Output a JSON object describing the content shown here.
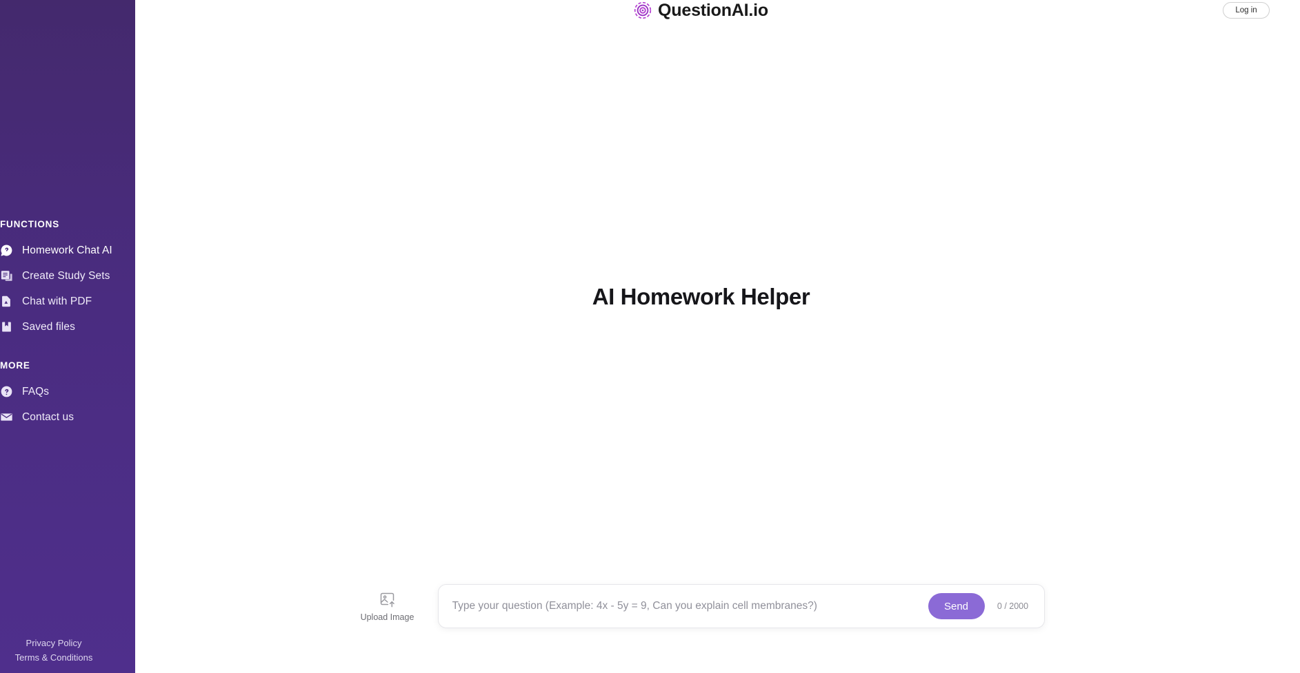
{
  "brand": {
    "name": "QuestionAI.io",
    "icon": "spiral-target-icon",
    "accent_color": "#b43fd0"
  },
  "header": {
    "login_label": "Log in"
  },
  "sidebar": {
    "background_color": "#4a2c80",
    "sections": [
      {
        "title": "FUNCTIONS",
        "items": [
          {
            "label": "Homework Chat AI",
            "icon": "chat-bubble-icon",
            "active": true
          },
          {
            "label": "Create Study Sets",
            "icon": "study-cards-icon",
            "active": false
          },
          {
            "label": "Chat with PDF",
            "icon": "pdf-file-icon",
            "active": false
          },
          {
            "label": "Saved files",
            "icon": "bookmark-icon",
            "active": false
          }
        ]
      },
      {
        "title": "MORE",
        "items": [
          {
            "label": "FAQs",
            "icon": "question-circle-icon",
            "active": false
          },
          {
            "label": "Contact us",
            "icon": "envelope-icon",
            "active": false
          }
        ]
      }
    ],
    "footer_links": [
      {
        "label": "Privacy Policy"
      },
      {
        "label": "Terms & Conditions"
      }
    ]
  },
  "main": {
    "hero_title": "AI Homework Helper"
  },
  "composer": {
    "upload": {
      "label": "Upload Image",
      "icon": "image-upload-icon"
    },
    "input": {
      "value": "",
      "placeholder": "Type your question (Example: 4x - 5y = 9, Can you explain cell membranes?)"
    },
    "send_label": "Send",
    "send_color": "#8b6ad6",
    "char_counter": "0 / 2000"
  }
}
